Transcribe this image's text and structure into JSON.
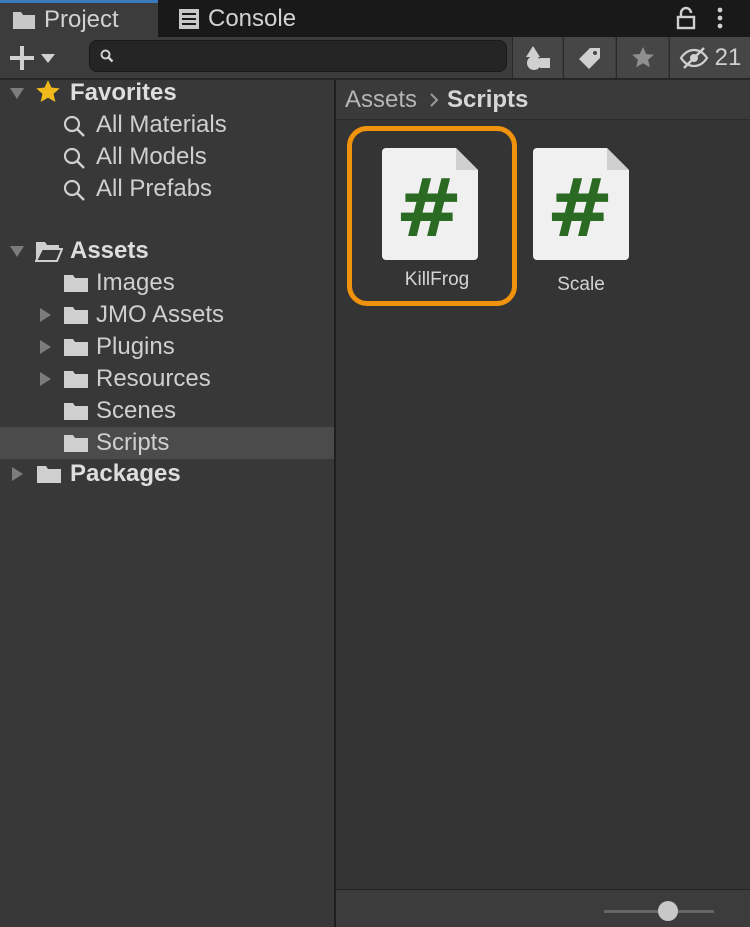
{
  "tabs": {
    "project": "Project",
    "console": "Console"
  },
  "toolbar": {
    "search_placeholder": "",
    "hidden_count": "21"
  },
  "tree": {
    "favorites": {
      "label": "Favorites",
      "items": [
        "All Materials",
        "All Models",
        "All Prefabs"
      ]
    },
    "assets": {
      "label": "Assets",
      "items": [
        "Images",
        "JMO Assets",
        "Plugins",
        "Resources",
        "Scenes",
        "Scripts"
      ]
    },
    "packages": "Packages"
  },
  "breadcrumb": {
    "root": "Assets",
    "current": "Scripts"
  },
  "assets_grid": [
    {
      "name": "KillFrog",
      "selected": true
    },
    {
      "name": "Scale",
      "selected": false
    }
  ],
  "colors": {
    "selection_outline": "#f0930c",
    "script_glyph": "#2a6a23",
    "tab_accent": "#3a79bb"
  },
  "icons": {
    "script": "#"
  }
}
